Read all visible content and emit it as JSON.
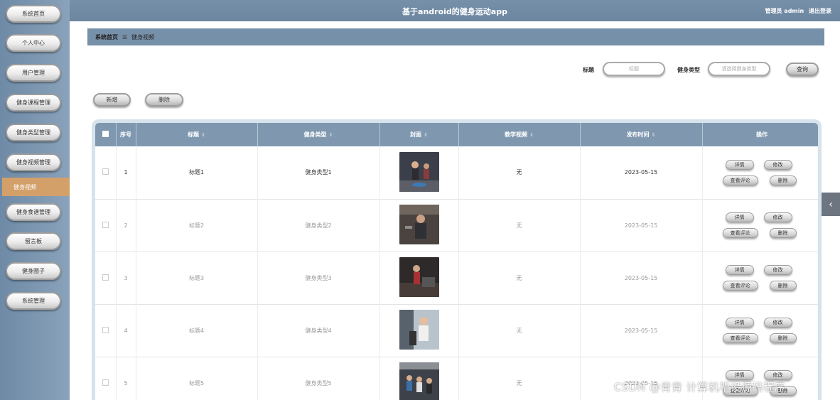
{
  "app_title": "基于android的健身运动app",
  "user": {
    "label": "管理员 admin",
    "logout": "退出登录"
  },
  "sidebar": {
    "items": [
      {
        "label": "系统首页"
      },
      {
        "label": "个人中心"
      },
      {
        "label": "用户管理"
      },
      {
        "label": "健身课程管理"
      },
      {
        "label": "健身类型管理"
      },
      {
        "label": "健身视频管理"
      },
      {
        "label": "健身食谱管理"
      },
      {
        "label": "留言板"
      },
      {
        "label": "健身圈子"
      },
      {
        "label": "系统管理"
      }
    ],
    "active": "健身视频"
  },
  "breadcrumb": {
    "home": "系统首页",
    "current": "健身视频"
  },
  "search": {
    "title_label": "标题",
    "title_placeholder": "标题",
    "type_label": "健身类型",
    "type_placeholder": "请选择健身类型",
    "query_button": "查询"
  },
  "actions": {
    "add": "新增",
    "delete": "删除"
  },
  "table": {
    "headers": [
      "序号",
      "标题",
      "健身类型",
      "封面",
      "教学视频",
      "发布时间",
      "操作"
    ],
    "row_buttons": {
      "detail": "详情",
      "edit": "修改",
      "comments": "查看评论",
      "delete": "删除"
    },
    "rows": [
      {
        "index": "1",
        "title": "标题1",
        "type": "健身类型1",
        "video": "无",
        "date": "2023-05-15"
      },
      {
        "index": "2",
        "title": "标题2",
        "type": "健身类型2",
        "video": "无",
        "date": "2023-05-15"
      },
      {
        "index": "3",
        "title": "标题3",
        "type": "健身类型3",
        "video": "无",
        "date": "2023-05-15"
      },
      {
        "index": "4",
        "title": "标题4",
        "type": "健身类型4",
        "video": "无",
        "date": "2023-05-15"
      },
      {
        "index": "5",
        "title": "标题5",
        "type": "健身类型5",
        "video": "无",
        "date": "2023-05-15"
      }
    ]
  },
  "watermark": "CSDN @青青  计算机毕设源码程序"
}
